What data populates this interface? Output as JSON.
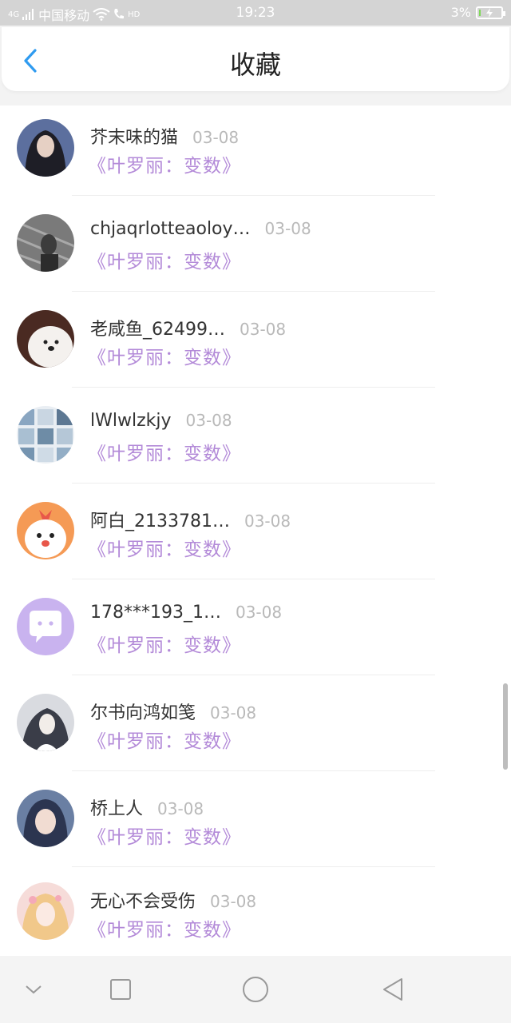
{
  "status_bar": {
    "network_tag": "4G",
    "carrier": "中国移动",
    "hd_tag": "HD",
    "time": "19:23",
    "battery_text": "3%",
    "battery_level": 0.03,
    "battery_color": "#7ed957"
  },
  "header": {
    "title": "收藏",
    "back_icon": "chevron-left-icon",
    "accent_color": "#2f9bf0"
  },
  "items": [
    {
      "name": "芥末味的猫",
      "date": "03-08",
      "book": "《叶罗丽：变数》"
    },
    {
      "name": "chjaqrlotteaoloy…",
      "date": "03-08",
      "book": "《叶罗丽：变数》"
    },
    {
      "name": "老咸鱼_62499…",
      "date": "03-08",
      "book": "《叶罗丽：变数》"
    },
    {
      "name": "lWlwlzkjy",
      "date": "03-08",
      "book": "《叶罗丽：变数》"
    },
    {
      "name": "阿白_2133781…",
      "date": "03-08",
      "book": "《叶罗丽：变数》"
    },
    {
      "name": "178***193_1…",
      "date": "03-08",
      "book": "《叶罗丽：变数》"
    },
    {
      "name": "尔书向鸿如笺",
      "date": "03-08",
      "book": "《叶罗丽：变数》"
    },
    {
      "name": "桥上人",
      "date": "03-08",
      "book": "《叶罗丽：变数》"
    },
    {
      "name": "无心不会受伤",
      "date": "03-08",
      "book": "《叶罗丽：变数》"
    }
  ],
  "book_color": "#b38ad8",
  "nav_bar": {
    "buttons": [
      "chevron-down-icon",
      "square-icon",
      "circle-icon",
      "triangle-back-icon"
    ]
  }
}
